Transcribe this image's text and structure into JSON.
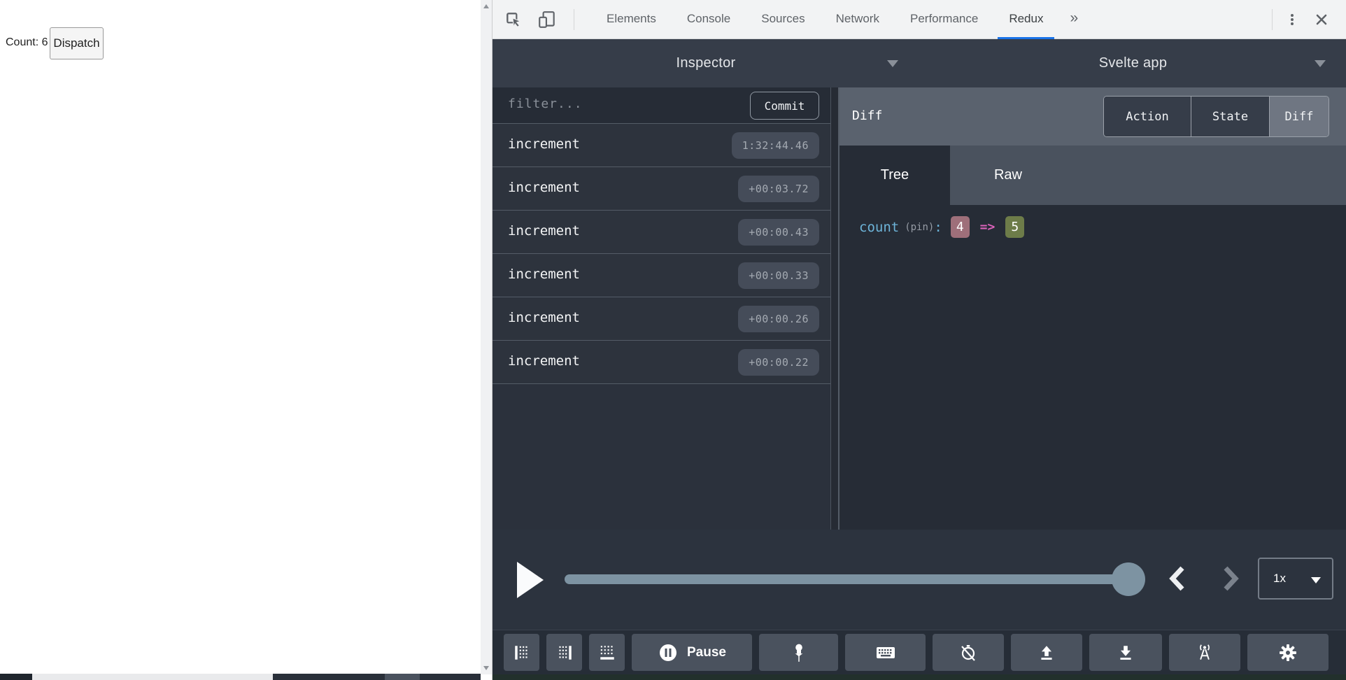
{
  "page": {
    "count_label": "Count: 6",
    "dispatch_button": "Dispatch"
  },
  "devtools": {
    "tabs": [
      "Elements",
      "Console",
      "Sources",
      "Network",
      "Performance",
      "Redux"
    ],
    "active_tab": "Redux",
    "more_tabs": "»",
    "accent_color": "#1a73e8"
  },
  "redux": {
    "monitor_selector": "Inspector",
    "instance_selector": "Svelte app",
    "filter_placeholder": "filter...",
    "commit_button": "Commit",
    "actions": [
      {
        "name": "increment",
        "time": "1:32:44.46"
      },
      {
        "name": "increment",
        "time": "+00:03.72"
      },
      {
        "name": "increment",
        "time": "+00:00.43"
      },
      {
        "name": "increment",
        "time": "+00:00.33"
      },
      {
        "name": "increment",
        "time": "+00:00.26"
      },
      {
        "name": "increment",
        "time": "+00:00.22"
      }
    ],
    "right_panel": {
      "title": "Diff",
      "views": [
        "Action",
        "State",
        "Diff"
      ],
      "selected_view": "Diff",
      "tabs": [
        "Tree",
        "Raw"
      ],
      "selected_tab": "Tree",
      "diff": {
        "key": "count",
        "meta": "(pin)",
        "colon": ":",
        "old_value": "4",
        "arrow": "=>",
        "new_value": "5",
        "old_color": "#9e6f7a",
        "new_color": "#6d7c49"
      }
    },
    "player": {
      "speed": "1x"
    },
    "toolbar": {
      "pause_label": "Pause",
      "icons": [
        "dock-left",
        "dock-right",
        "dock-bottom",
        "pause",
        "pin",
        "keyboard",
        "stopwatch-off",
        "upload",
        "download",
        "broadcast",
        "settings"
      ]
    }
  }
}
